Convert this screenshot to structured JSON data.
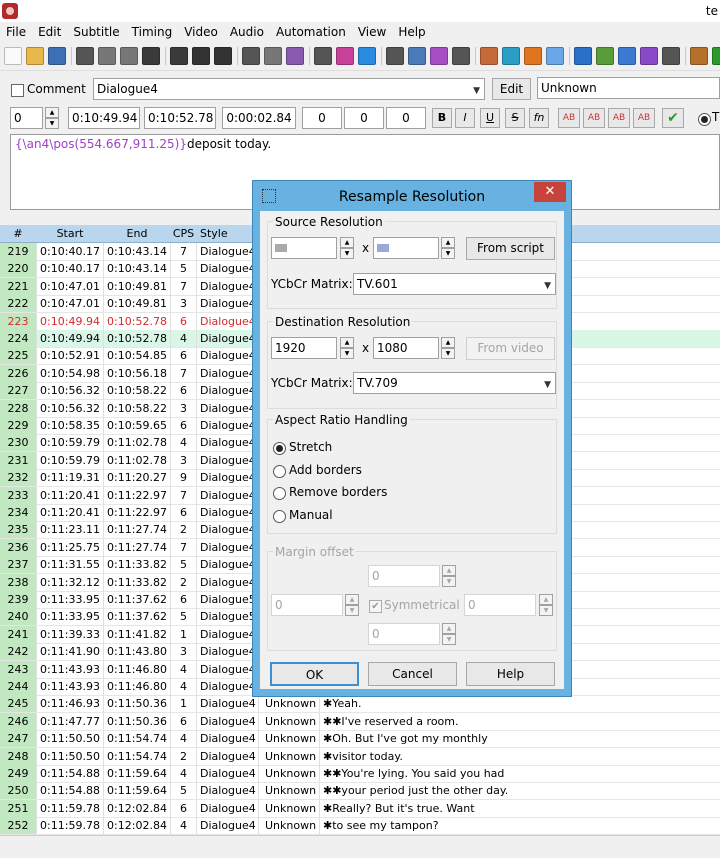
{
  "window": {
    "title_fragment": "te"
  },
  "menu": [
    "File",
    "Edit",
    "Subtitle",
    "Timing",
    "Video",
    "Audio",
    "Automation",
    "View",
    "Help"
  ],
  "toolbar": {
    "icons": [
      "new-file-icon",
      "open-file-icon",
      "save-icon",
      "jump-icon",
      "zoom-in-icon",
      "zoom-out-icon",
      "video-open-icon",
      "video-close-icon",
      "keyframes-icon",
      "audio-icon",
      "subtitle-icon",
      "styles-icon",
      "attachments-icon",
      "fonts-icon",
      "automation-icon",
      "properties-icon",
      "find-icon",
      "replace-icon",
      "spell-icon",
      "lock-icon",
      "shift-times-icon",
      "timing-post-icon",
      "kanji-timer-icon",
      "translation-icon",
      "resample-icon",
      "fit-icon",
      "clock-icon",
      "options-icon",
      "dev-icon",
      "hammer-icon",
      "check-icon",
      "tag-icon"
    ]
  },
  "editor": {
    "comment_label": "Comment",
    "style": "Dialogue4",
    "edit_button": "Edit",
    "actor": "Unknown",
    "layer": "0",
    "start": "0:10:49.94",
    "end": "0:10:52.78",
    "duration": "0:00:02.84",
    "margin_l": "0",
    "margin_r": "0",
    "margin_v": "0",
    "format_buttons": [
      "B",
      "I",
      "U",
      "S",
      "fn",
      "AB",
      "AB",
      "AB",
      "AB"
    ],
    "text_tag_open": "{\\an4\\pos(554.667,911.25)}",
    "text_body": "deposit today."
  },
  "grid": {
    "headers": [
      "#",
      "Start",
      "End",
      "CPS",
      "Style"
    ],
    "rows": [
      {
        "n": "219",
        "start": "0:10:40.17",
        "end": "0:10:43.14",
        "cps": "7",
        "style": "Dialogue4",
        "actor": "",
        "text": ""
      },
      {
        "n": "220",
        "start": "0:10:40.17",
        "end": "0:10:43.14",
        "cps": "5",
        "style": "Dialogue4",
        "actor": "",
        "text": ""
      },
      {
        "n": "221",
        "start": "0:10:47.01",
        "end": "0:10:49.81",
        "cps": "7",
        "style": "Dialogue4",
        "actor": "",
        "text": ""
      },
      {
        "n": "222",
        "start": "0:10:47.01",
        "end": "0:10:49.81",
        "cps": "3",
        "style": "Dialogue4",
        "actor": "",
        "text": ""
      },
      {
        "n": "223",
        "start": "0:10:49.94",
        "end": "0:10:52.78",
        "cps": "6",
        "style": "Dialogue4",
        "actor": "",
        "text": "",
        "state": "red"
      },
      {
        "n": "224",
        "start": "0:10:49.94",
        "end": "0:10:52.78",
        "cps": "4",
        "style": "Dialogue4",
        "actor": "",
        "text": "",
        "state": "sel"
      },
      {
        "n": "225",
        "start": "0:10:52.91",
        "end": "0:10:54.85",
        "cps": "6",
        "style": "Dialogue4",
        "actor": "",
        "text": ""
      },
      {
        "n": "226",
        "start": "0:10:54.98",
        "end": "0:10:56.18",
        "cps": "7",
        "style": "Dialogue4",
        "actor": "",
        "text": ""
      },
      {
        "n": "227",
        "start": "0:10:56.32",
        "end": "0:10:58.22",
        "cps": "6",
        "style": "Dialogue4",
        "actor": "",
        "text": ""
      },
      {
        "n": "228",
        "start": "0:10:56.32",
        "end": "0:10:58.22",
        "cps": "3",
        "style": "Dialogue4",
        "actor": "",
        "text": ""
      },
      {
        "n": "229",
        "start": "0:10:58.35",
        "end": "0:10:59.65",
        "cps": "6",
        "style": "Dialogue4",
        "actor": "",
        "text": ""
      },
      {
        "n": "230",
        "start": "0:10:59.79",
        "end": "0:11:02.78",
        "cps": "4",
        "style": "Dialogue4",
        "actor": "",
        "text": ""
      },
      {
        "n": "231",
        "start": "0:10:59.79",
        "end": "0:11:02.78",
        "cps": "3",
        "style": "Dialogue4",
        "actor": "",
        "text": ""
      },
      {
        "n": "232",
        "start": "0:11:19.31",
        "end": "0:11:20.27",
        "cps": "9",
        "style": "Dialogue4",
        "actor": "",
        "text": ""
      },
      {
        "n": "233",
        "start": "0:11:20.41",
        "end": "0:11:22.97",
        "cps": "7",
        "style": "Dialogue4",
        "actor": "",
        "text": ""
      },
      {
        "n": "234",
        "start": "0:11:20.41",
        "end": "0:11:22.97",
        "cps": "6",
        "style": "Dialogue4",
        "actor": "",
        "text": ""
      },
      {
        "n": "235",
        "start": "0:11:23.11",
        "end": "0:11:27.74",
        "cps": "2",
        "style": "Dialogue4",
        "actor": "",
        "text": ""
      },
      {
        "n": "236",
        "start": "0:11:25.75",
        "end": "0:11:27.74",
        "cps": "7",
        "style": "Dialogue4",
        "actor": "",
        "text": ""
      },
      {
        "n": "237",
        "start": "0:11:31.55",
        "end": "0:11:33.82",
        "cps": "5",
        "style": "Dialogue4",
        "actor": "",
        "text": ""
      },
      {
        "n": "238",
        "start": "0:11:32.12",
        "end": "0:11:33.82",
        "cps": "2",
        "style": "Dialogue4",
        "actor": "",
        "text": ""
      },
      {
        "n": "239",
        "start": "0:11:33.95",
        "end": "0:11:37.62",
        "cps": "6",
        "style": "Dialogue5",
        "actor": "",
        "text": ""
      },
      {
        "n": "240",
        "start": "0:11:33.95",
        "end": "0:11:37.62",
        "cps": "5",
        "style": "Dialogue5",
        "actor": "",
        "text": ""
      },
      {
        "n": "241",
        "start": "0:11:39.33",
        "end": "0:11:41.82",
        "cps": "1",
        "style": "Dialogue4",
        "actor": "",
        "text": ""
      },
      {
        "n": "242",
        "start": "0:11:41.90",
        "end": "0:11:43.80",
        "cps": "3",
        "style": "Dialogue4",
        "actor": "",
        "text": ""
      },
      {
        "n": "243",
        "start": "0:11:43.93",
        "end": "0:11:46.80",
        "cps": "4",
        "style": "Dialogue4",
        "actor": "",
        "text": ""
      },
      {
        "n": "244",
        "start": "0:11:43.93",
        "end": "0:11:46.80",
        "cps": "4",
        "style": "Dialogue4",
        "actor": "",
        "text": ""
      },
      {
        "n": "245",
        "start": "0:11:46.93",
        "end": "0:11:50.36",
        "cps": "1",
        "style": "Dialogue4",
        "actor": "Unknown",
        "text": "✱Yeah."
      },
      {
        "n": "246",
        "start": "0:11:47.77",
        "end": "0:11:50.36",
        "cps": "6",
        "style": "Dialogue4",
        "actor": "Unknown",
        "text": "✱✱I've reserved a room."
      },
      {
        "n": "247",
        "start": "0:11:50.50",
        "end": "0:11:54.74",
        "cps": "4",
        "style": "Dialogue4",
        "actor": "Unknown",
        "text": "✱Oh. But I've got my monthly"
      },
      {
        "n": "248",
        "start": "0:11:50.50",
        "end": "0:11:54.74",
        "cps": "2",
        "style": "Dialogue4",
        "actor": "Unknown",
        "text": "✱visitor today."
      },
      {
        "n": "249",
        "start": "0:11:54.88",
        "end": "0:11:59.64",
        "cps": "4",
        "style": "Dialogue4",
        "actor": "Unknown",
        "text": "✱✱You're lying. You said you had"
      },
      {
        "n": "250",
        "start": "0:11:54.88",
        "end": "0:11:59.64",
        "cps": "5",
        "style": "Dialogue4",
        "actor": "Unknown",
        "text": "✱✱your period just the other day."
      },
      {
        "n": "251",
        "start": "0:11:59.78",
        "end": "0:12:02.84",
        "cps": "6",
        "style": "Dialogue4",
        "actor": "Unknown",
        "text": "✱Really? But it's true. Want"
      },
      {
        "n": "252",
        "start": "0:11:59.78",
        "end": "0:12:02.84",
        "cps": "4",
        "style": "Dialogue4",
        "actor": "Unknown",
        "text": "✱to see my tampon?"
      }
    ]
  },
  "dialog": {
    "title": "Resample Resolution",
    "close": "✕",
    "source_group": "Source Resolution",
    "source_x_sep": "x",
    "from_script": "From script",
    "ycbcr_label": "YCbCr Matrix:",
    "source_matrix": "TV.601",
    "dest_group": "Destination Resolution",
    "dest_w": "1920",
    "dest_h": "1080",
    "dest_x_sep": "x",
    "from_video": "From video",
    "dest_matrix": "TV.709",
    "aspect_group": "Aspect Ratio Handling",
    "aspect_options": [
      "Stretch",
      "Add borders",
      "Remove borders",
      "Manual"
    ],
    "aspect_selected": 0,
    "margin_group": "Margin offset",
    "margin_top": "0",
    "margin_left": "0",
    "margin_right": "0",
    "margin_bottom": "0",
    "symmetrical": "Symmetrical",
    "ok": "OK",
    "cancel": "Cancel",
    "help": "Help"
  },
  "colors": {
    "dialog_frame": "#67b2e0",
    "grid_header": "#b9d6ee",
    "number_col": "#c2e8c2",
    "selected_row": "#d9f6e6",
    "highlight_text": "#d52a2a",
    "close_button": "#c7443c"
  }
}
